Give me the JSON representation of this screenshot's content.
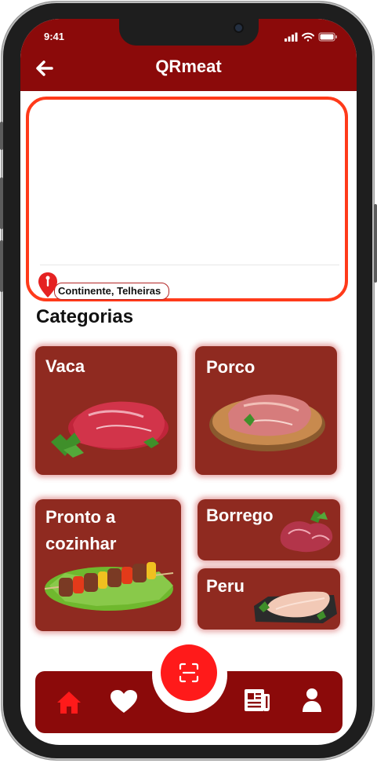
{
  "status": {
    "time": "9:41"
  },
  "header": {
    "title": "QRmeat"
  },
  "location": {
    "label": "Continente, Telheiras"
  },
  "categories": {
    "title": "Categorias",
    "items": [
      {
        "label": "Vaca"
      },
      {
        "label": "Porco"
      },
      {
        "label": "Pronto a cozinhar"
      },
      {
        "label": "Borrego"
      },
      {
        "label": "Peru"
      }
    ]
  },
  "colors": {
    "primary": "#8b0a0a",
    "card": "#8f2a20",
    "accent": "#ff1a1a",
    "map_border": "#ff3a1a"
  },
  "nav": {
    "items": [
      {
        "icon": "home-icon",
        "active": true
      },
      {
        "icon": "heart-icon"
      },
      {
        "icon": "scan-icon"
      },
      {
        "icon": "newspaper-icon"
      },
      {
        "icon": "user-icon"
      }
    ]
  }
}
